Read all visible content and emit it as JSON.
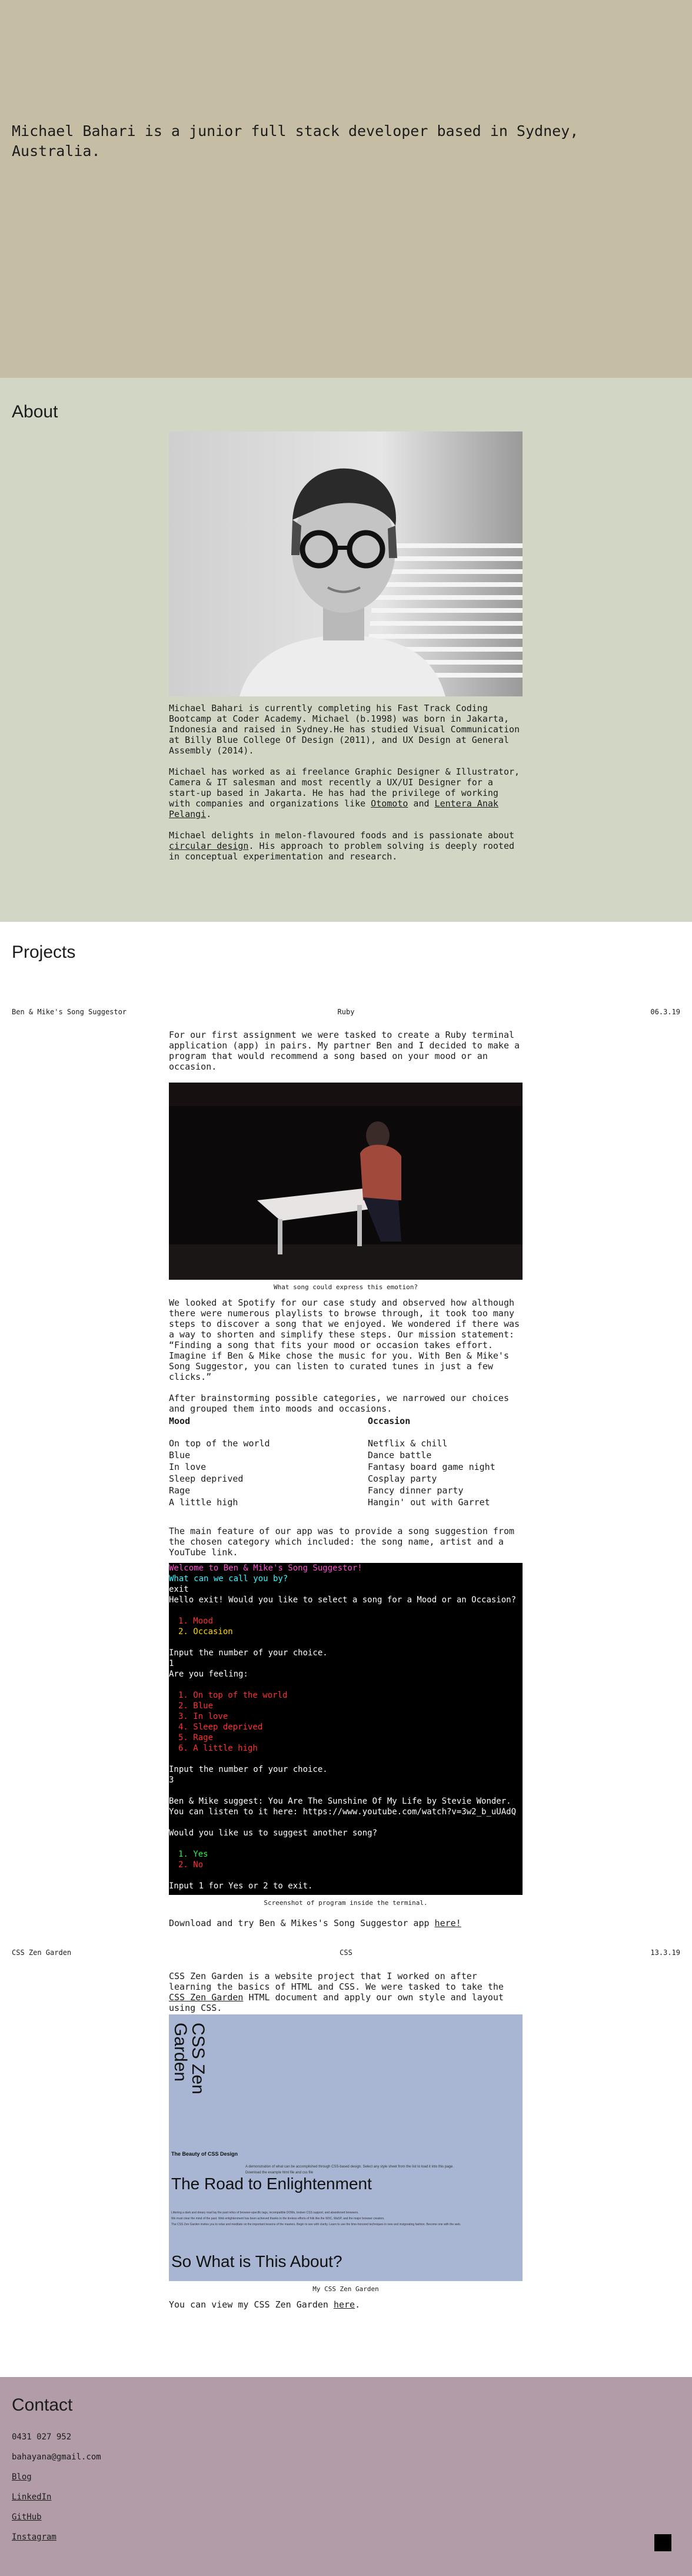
{
  "hero": {
    "text": "Michael Bahari is a junior full stack developer based in Sydney, Australia."
  },
  "about": {
    "title": "About",
    "paragraphs": [
      "Michael Bahari is currently completing his Fast Track Coding Bootcamp at Coder Academy. Michael (b.1998) was born in Jakarta, Indonesia and raised in Sydney.He has studied Visual Communication at Billy Blue College Of Design (2011), and UX Design at General Assembly (2014).",
      "Michael has worked as ai freelance Graphic Designer & Illustrator, Camera & IT salesman and most recently a UX/UI Designer for a start-up based in Jakarta. He has had the privilege of working with companies and organizations like",
      "and",
      "Michael delights in melon-flavoured foods and is passionate about",
      ". His approach to problem solving is deeply rooted in conceptual experimentation and research."
    ],
    "links": {
      "otomoto": "Otomoto",
      "lentera": "Lentera Anak Pelangi",
      "circular": "circular design"
    }
  },
  "projects": {
    "title": "Projects",
    "project1": {
      "name": "Ben & Mike's Song Suggestor",
      "tech": "Ruby",
      "date": "06.3.19",
      "intro": "For our first assignment we were tasked to create a Ruby terminal application (app) in pairs. My partner Ben and I decided to make a program that would recommend a song based on your mood or an occasion.",
      "caption1": "What song could express this emotion?",
      "para2": "We looked at Spotify for our case study and observed how although there were numerous playlists to browse through, it took too many steps to discover a song that we enjoyed. We wondered if there was a way to shorten and simplify these steps. Our mission statement: “Finding a song that fits your mood or occasion takes effort. Imagine if Ben & Mike chose the music for you. With Ben & Mike's Song Suggestor, you can listen to curated tunes in just a few clicks.”",
      "para3": "After brainstorming possible categories, we narrowed our choices and grouped them into moods and occasions.",
      "mood_heading": "Mood",
      "moods": [
        "On top of the world",
        "Blue",
        "In love",
        "Sleep deprived",
        "Rage",
        "A little high"
      ],
      "occasion_heading": "Occasion",
      "occasions": [
        "Netflix & chill",
        "Dance battle",
        "Fantasy board game night",
        "Cosplay party",
        "Fancy dinner party",
        "Hangin' out with Garret"
      ],
      "para4": "The main feature of our app was to provide a song suggestion from the chosen category which included: the song name, artist and a YouTube link.",
      "terminal": {
        "welcome": "Welcome to Ben & Mike's Song Suggestor!",
        "prompt_name": "What can we call you by?",
        "exit": "exit",
        "hello": "Hello exit! Would you like to select a song for a Mood or an Occasion?",
        "opt1": "1. Mood",
        "opt2": "2. Occasion",
        "input_choice": "Input the number of your choice.",
        "one": "1",
        "are_you": "Are you feeling:",
        "mood_opts": [
          "1. On top of the world",
          "2. Blue",
          "3. In love",
          "4. Sleep deprived",
          "5. Rage",
          "6. A little high"
        ],
        "input_choice2": "Input the number of your choice.",
        "three": "3",
        "suggest1": "Ben & Mike suggest: You Are The Sunshine Of My Life by Stevie Wonder.",
        "suggest2": "You can listen to it here: https://www.youtube.com/watch?v=3w2_b_uUAdQ",
        "again": "Would you like us to suggest another song?",
        "yes": "1. Yes",
        "no": "2. No",
        "input_yes": "Input 1 for Yes or 2 to exit."
      },
      "caption2": "Screenshot of program inside the terminal.",
      "download_text": "Download and try Ben & Mikes's Song Suggestor app",
      "download_link": "here!"
    },
    "project2": {
      "name": "CSS Zen Garden",
      "tech": "CSS",
      "date": "13.3.19",
      "intro_a": "CSS Zen Garden is a website project that I worked on after learning the basics of HTML and CSS. We were tasked to take the",
      "intro_link": "CSS Zen Garden",
      "intro_b": "HTML document and apply our own style and layout using CSS.",
      "zen": {
        "vertical_title": "CSS Zen Garden",
        "beauty": "The Beauty of CSS Design",
        "small_line_1": "A demonstration of what can be accomplished through CSS-based design. Select any style sheet from the list to load it into this page.",
        "small_line_2": "Download the example html file and css file",
        "road": "The Road to Enlightenment",
        "small_road_1": "Littering a dark and dreary road lay the past relics of browser-specific tags, incompatible DOMs, broken CSS support, and abandoned browsers.",
        "small_road_2": "We must clear the mind of the past. Web enlightenment has been achieved thanks to the tireless efforts of folk like the W3C, WaSP, and the major browser creators.",
        "small_road_3": "The CSS Zen Garden invites you to relax and meditate on the important lessons of the masters. Begin to see with clarity. Learn to use the time-honored techniques in new and invigorating fashion. Become one with the web.",
        "what": "So What is This About?"
      },
      "caption": "My CSS Zen Garden",
      "view_text": "You can view my CSS Zen Garden",
      "view_link": "here"
    }
  },
  "contact": {
    "title": "Contact",
    "phone": "0431 027 952",
    "email": "bahayana@gmail.com",
    "links": [
      "Blog",
      "LinkedIn",
      "GitHub",
      "Instagram"
    ]
  },
  "colors": {
    "hero_bg": "#c6bda5",
    "about_bg": "#d1d6c5",
    "projects_bg": "#ffffff",
    "contact_bg": "#b19ca7",
    "zen_bg": "#a8b6d3"
  }
}
